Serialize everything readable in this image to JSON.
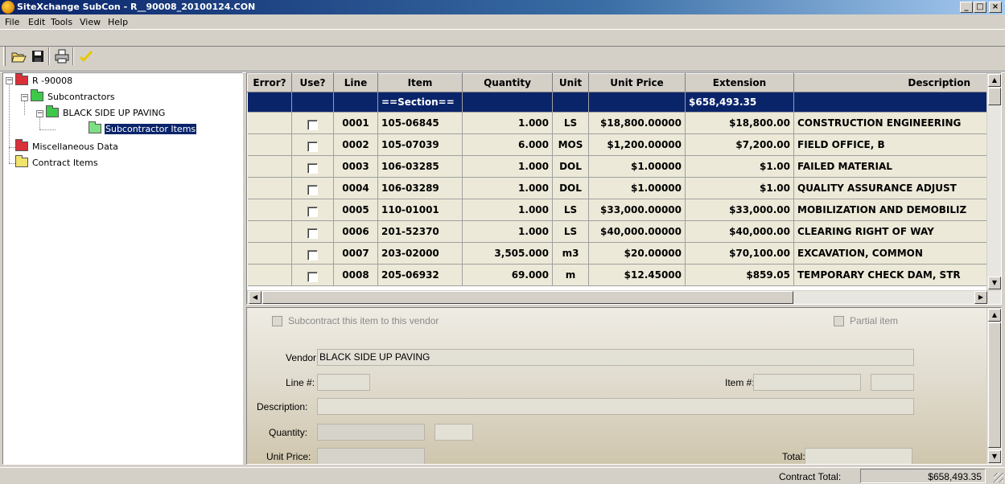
{
  "window": {
    "title": "SiteXchange SubCon - R__90008_20100124.CON",
    "controls": [
      "_",
      "□",
      "×"
    ]
  },
  "menu": [
    "File",
    "Edit",
    "Tools",
    "View",
    "Help"
  ],
  "toolbar": {
    "buttons": [
      "open-folder-icon",
      "save-icon",
      "print-icon",
      "checkmark-icon"
    ]
  },
  "tree": {
    "root": "R -90008",
    "subcontractors": "Subcontractors",
    "vendor": "BLACK SIDE UP PAVING",
    "subcontractor_items": "Subcontractor Items",
    "misc": "Miscellaneous Data",
    "contract_items": "Contract Items"
  },
  "grid": {
    "columns": [
      "Error?",
      "Use?",
      "Line",
      "Item",
      "Quantity",
      "Unit",
      "Unit Price",
      "Extension",
      "Description"
    ],
    "section": {
      "item": "==Section==",
      "extension": "$658,493.35"
    },
    "rows": [
      {
        "line": "0001",
        "item": "105-06845",
        "quantity": "1.000",
        "unit": "LS",
        "unit_price": "$18,800.00000",
        "extension": "$18,800.00",
        "description": "CONSTRUCTION ENGINEERING"
      },
      {
        "line": "0002",
        "item": "105-07039",
        "quantity": "6.000",
        "unit": "MOS",
        "unit_price": "$1,200.00000",
        "extension": "$7,200.00",
        "description": "FIELD OFFICE, B"
      },
      {
        "line": "0003",
        "item": "106-03285",
        "quantity": "1.000",
        "unit": "DOL",
        "unit_price": "$1.00000",
        "extension": "$1.00",
        "description": "FAILED MATERIAL"
      },
      {
        "line": "0004",
        "item": "106-03289",
        "quantity": "1.000",
        "unit": "DOL",
        "unit_price": "$1.00000",
        "extension": "$1.00",
        "description": "QUALITY ASSURANCE ADJUST"
      },
      {
        "line": "0005",
        "item": "110-01001",
        "quantity": "1.000",
        "unit": "LS",
        "unit_price": "$33,000.00000",
        "extension": "$33,000.00",
        "description": "MOBILIZATION AND DEMOBILIZ"
      },
      {
        "line": "0006",
        "item": "201-52370",
        "quantity": "1.000",
        "unit": "LS",
        "unit_price": "$40,000.00000",
        "extension": "$40,000.00",
        "description": "CLEARING RIGHT OF WAY"
      },
      {
        "line": "0007",
        "item": "203-02000",
        "quantity": "3,505.000",
        "unit": "m3",
        "unit_price": "$20.00000",
        "extension": "$70,100.00",
        "description": "EXCAVATION, COMMON"
      },
      {
        "line": "0008",
        "item": "205-06932",
        "quantity": "69.000",
        "unit": "m",
        "unit_price": "$12.45000",
        "extension": "$859.05",
        "description": "TEMPORARY CHECK DAM, STR"
      }
    ]
  },
  "details": {
    "subcontract_label": "Subcontract this item to this vendor",
    "partial_label": "Partial item",
    "vendor_label": "Vendor:",
    "vendor_value": "BLACK SIDE UP PAVING",
    "line_label": "Line #:",
    "item_label": "Item #:",
    "description_label": "Description:",
    "quantity_label": "Quantity:",
    "unit_price_label": "Unit Price:",
    "total_label": "Total:"
  },
  "status": {
    "contract_total_label": "Contract Total:",
    "contract_total_value": "$658,493.35"
  },
  "colors": {
    "selection": "#0a246a",
    "grid_row": "#ece9d8"
  }
}
